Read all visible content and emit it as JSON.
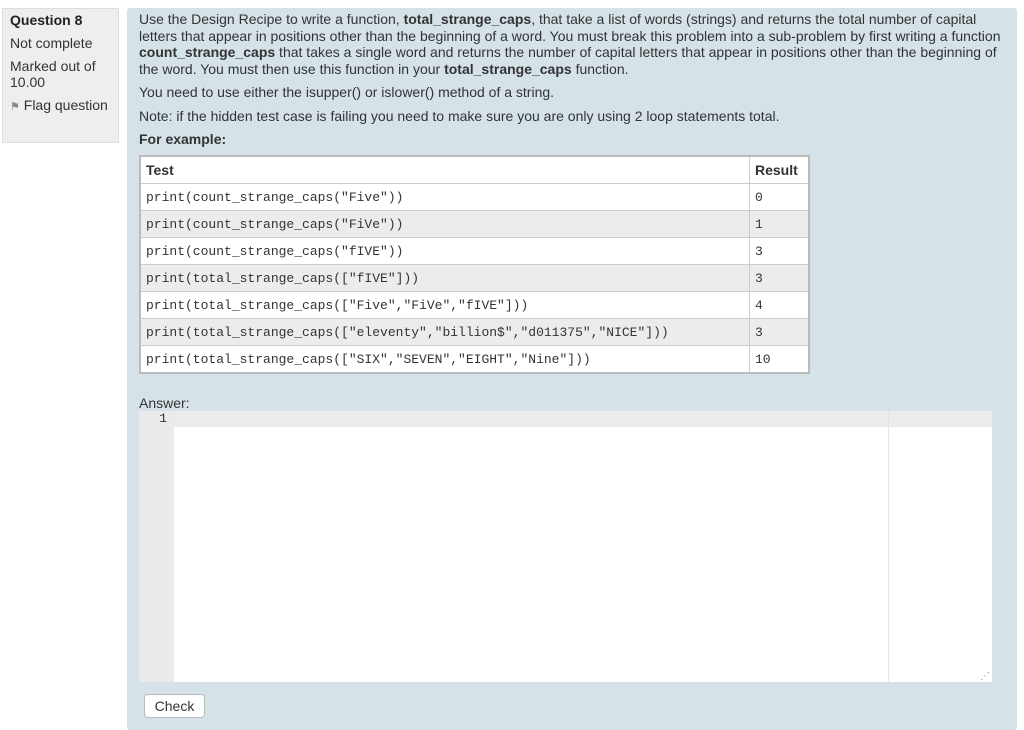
{
  "info": {
    "question_label": "Question",
    "question_number": "8",
    "status": "Not complete",
    "marked_out_of": "Marked out of 10.00",
    "flag_label": "Flag question",
    "flag_icon": "flag-icon"
  },
  "question": {
    "p1": [
      "Use the Design Recipe to write a function, ",
      "total_strange_caps",
      ", that take a list of words (strings) and returns the total number of capital letters that appear in positions other than the beginning of a word. You must break this problem into a sub-problem by first writing a function ",
      "count_strange_caps",
      " that takes a single word and returns the number of capital letters that appear in positions other than the beginning of the word. You must then use this function in your ",
      "total_strange_caps",
      " function."
    ],
    "p2": "You need to use either the isupper() or islower() method of a string.",
    "p3": "Note: if the hidden test case is failing you need to make sure you are only using 2 loop statements total.",
    "example_label": "For example:"
  },
  "table": {
    "headers": [
      "Test",
      "Result"
    ],
    "rows": [
      [
        "print(count_strange_caps(\"Five\"))",
        "0"
      ],
      [
        "print(count_strange_caps(\"FiVe\"))",
        "1"
      ],
      [
        "print(count_strange_caps(\"fIVE\"))",
        "3"
      ],
      [
        "print(total_strange_caps([\"fIVE\"]))",
        "3"
      ],
      [
        "print(total_strange_caps([\"Five\",\"FiVe\",\"fIVE\"]))",
        "4"
      ],
      [
        "print(total_strange_caps([\"eleventy\",\"billion$\",\"d011375\",\"NICE\"]))",
        "3"
      ],
      [
        "print(total_strange_caps([\"SIX\",\"SEVEN\",\"EIGHT\",\"Nine\"]))",
        "10"
      ]
    ]
  },
  "answer": {
    "label": "Answer:",
    "line_number": "1",
    "value": ""
  },
  "check_label": "Check"
}
